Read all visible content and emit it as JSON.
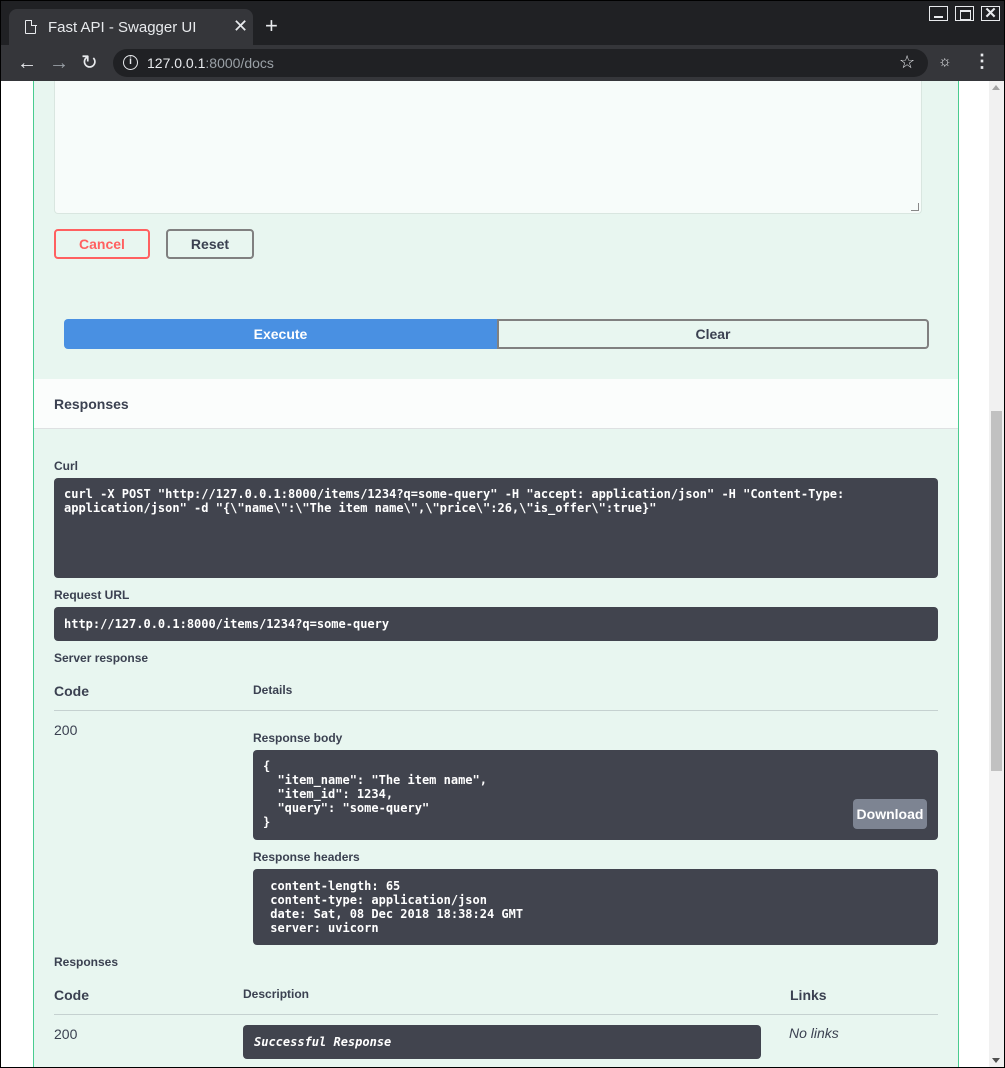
{
  "browser": {
    "tab_title": "Fast API - Swagger UI",
    "tab_close": "✕",
    "new_tab": "+",
    "url_host": "127.0.0.1",
    "url_rest": ":8000/docs",
    "window_close": "✕"
  },
  "form": {
    "cancel_label": "Cancel",
    "reset_label": "Reset",
    "execute_label": "Execute",
    "clear_label": "Clear"
  },
  "responses_section": {
    "title": "Responses",
    "curl_label": "Curl",
    "curl_lines": [
      "curl -X POST \"http://127.0.0.1:8000/items/1234?q=some-query\" -H \"accept: application/json\" -H \"Content-Type:",
      "application/json\" -d \"{\\\"name\\\":\\\"The item name\\\",\\\"price\\\":26,\\\"is_offer\\\":true}\""
    ],
    "request_url_label": "Request URL",
    "request_url": "http://127.0.0.1:8000/items/1234?q=some-query",
    "server_response_label": "Server response",
    "code_header": "Code",
    "details_header": "Details",
    "code": "200",
    "response_body_label": "Response body",
    "response_body_lines": [
      "{",
      "  \"item_name\": \"The item name\",",
      "  \"item_id\": 1234,",
      "  \"query\": \"some-query\"",
      "}"
    ],
    "download_label": "Download",
    "response_headers_label": "Response headers",
    "response_headers_lines": [
      " content-length: 65",
      " content-type: application/json",
      " date: Sat, 08 Dec 2018 18:38:24 GMT",
      " server: uvicorn"
    ]
  },
  "documented_responses": {
    "title": "Responses",
    "code_header": "Code",
    "description_header": "Description",
    "links_header": "Links",
    "code": "200",
    "description": "Successful Response",
    "links": "No links"
  },
  "colors": {
    "execute": "#4990e2",
    "cancel": "#ff6060",
    "post_border": "#49cc90",
    "code_bg": "#41444e"
  }
}
